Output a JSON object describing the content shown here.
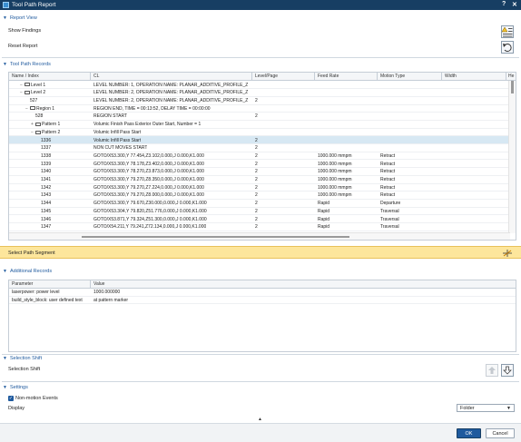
{
  "window": {
    "title": "Tool Path Report",
    "help_glyph": "?",
    "close_glyph": "✕"
  },
  "report_view": {
    "header": "Report View",
    "show_findings": "Show Findings",
    "reset_report": "Reset Report"
  },
  "records": {
    "header": "Tool Path Records",
    "columns": [
      "Name / Index",
      "CL",
      "Level/Page",
      "Feed Rate",
      "Motion Type",
      "Width",
      "He"
    ],
    "rows": [
      {
        "indent": 2,
        "expander": "−",
        "folder": true,
        "name": "Level 1",
        "cl": "LEVEL NUMBER: 1, OPERATION NAME: PLANAR_ADDITIVE_PROFILE_Z...",
        "level": "",
        "feed": "",
        "motion": "",
        "selected": false
      },
      {
        "indent": 2,
        "expander": "−",
        "folder": true,
        "name": "Level 2",
        "cl": "LEVEL NUMBER: 2, OPERATION NAME: PLANAR_ADDITIVE_PROFILE_Z...",
        "level": "",
        "feed": "",
        "motion": "",
        "selected": false
      },
      {
        "indent": 3,
        "expander": "",
        "folder": false,
        "name": "527",
        "cl": "LEVEL NUMBER: 2, OPERATION NAME: PLANAR_ADDITIVE_PROFILE_Z...",
        "level": "2",
        "feed": "",
        "motion": "",
        "selected": false
      },
      {
        "indent": 3,
        "expander": "−",
        "folder": true,
        "name": "Region 1",
        "cl": "REGION END, TIME = 00:13:52, DELAY TIME = 00:00:00",
        "level": "",
        "feed": "",
        "motion": "",
        "selected": false
      },
      {
        "indent": 4,
        "expander": "",
        "folder": false,
        "name": "528",
        "cl": "REGION START",
        "level": "2",
        "feed": "",
        "motion": "",
        "selected": false
      },
      {
        "indent": 4,
        "expander": "+",
        "folder": true,
        "name": "Pattern 1",
        "cl": "Volumic Finish Pass Exterior Outer Start, Number = 1",
        "level": "",
        "feed": "",
        "motion": "",
        "selected": false
      },
      {
        "indent": 4,
        "expander": "−",
        "folder": true,
        "name": "Pattern 2",
        "cl": "Volumic Infill Pass Start",
        "level": "",
        "feed": "",
        "motion": "",
        "selected": false
      },
      {
        "indent": 5,
        "expander": "",
        "folder": false,
        "name": "1336",
        "cl": "Volumic Infill Pass Start",
        "level": "2",
        "feed": "",
        "motion": "",
        "selected": true
      },
      {
        "indent": 5,
        "expander": "",
        "folder": false,
        "name": "1337",
        "cl": "NON CUT MOVES START",
        "level": "2",
        "feed": "",
        "motion": "",
        "selected": false
      },
      {
        "indent": 5,
        "expander": "",
        "folder": false,
        "name": "1338",
        "cl": "GOTO/X53.300,Y 77.454,Z3.102,0.000,J 0.000,K1.000",
        "level": "2",
        "feed": "1000.000 mmpm",
        "motion": "Retract",
        "selected": false
      },
      {
        "indent": 5,
        "expander": "",
        "folder": false,
        "name": "1339",
        "cl": "GOTO/X53.300,Y 78.178,Z3.402,0.000,J 0.000,K1.000",
        "level": "2",
        "feed": "1000.000 mmpm",
        "motion": "Retract",
        "selected": false
      },
      {
        "indent": 5,
        "expander": "",
        "folder": false,
        "name": "1340",
        "cl": "GOTO/X53.300,Y 78.270,Z3.873,0.000,J 0.000,K1.000",
        "level": "2",
        "feed": "1000.000 mmpm",
        "motion": "Retract",
        "selected": false
      },
      {
        "indent": 5,
        "expander": "",
        "folder": false,
        "name": "1341",
        "cl": "GOTO/X53.300,Y 79.270,Z8.350,0.000,J 0.000,K1.000",
        "level": "2",
        "feed": "1000.000 mmpm",
        "motion": "Retract",
        "selected": false
      },
      {
        "indent": 5,
        "expander": "",
        "folder": false,
        "name": "1342",
        "cl": "GOTO/X53.300,Y 79.270,Z7.224,0.000,J 0.000,K1.000",
        "level": "2",
        "feed": "1000.000 mmpm",
        "motion": "Retract",
        "selected": false
      },
      {
        "indent": 5,
        "expander": "",
        "folder": false,
        "name": "1343",
        "cl": "GOTO/X53.300,Y 79.270,Z8.000,0.000,J 0.000,K1.000",
        "level": "2",
        "feed": "1000.000 mmpm",
        "motion": "Retract",
        "selected": false
      },
      {
        "indent": 5,
        "expander": "",
        "folder": false,
        "name": "1344",
        "cl": "GOTO/X53.300,Y 79.670,Z30.000,0.000,J 0.000,K1.000",
        "level": "2",
        "feed": "Rapid",
        "motion": "Departure",
        "selected": false
      },
      {
        "indent": 5,
        "expander": "",
        "folder": false,
        "name": "1345",
        "cl": "GOTO/X53.304,Y 79.820,Z51.776,0.000,J 0.000,K1.000",
        "level": "2",
        "feed": "Rapid",
        "motion": "Traversal",
        "selected": false
      },
      {
        "indent": 5,
        "expander": "",
        "folder": false,
        "name": "1346",
        "cl": "GOTO/X53.871,Y 79.324,Z51.300,0.000,J 0.000,K1.000",
        "level": "2",
        "feed": "Rapid",
        "motion": "Traversal",
        "selected": false
      },
      {
        "indent": 5,
        "expander": "",
        "folder": false,
        "name": "1347",
        "cl": "GOTO/X54.211,Y 79.241,Z72.134,0.000,J 0.000,K1.000",
        "level": "2",
        "feed": "Rapid",
        "motion": "Traversal",
        "selected": false
      }
    ]
  },
  "status": {
    "select_path": "Select Path Segment"
  },
  "additional": {
    "header": "Additional Records",
    "columns": [
      "Parameter",
      "Value"
    ],
    "rows": [
      {
        "param": "laserpower: power level",
        "value": "1000.000000"
      },
      {
        "param": "build_style_block: user defined text",
        "value": "at pattern marker"
      }
    ]
  },
  "selection_shift": {
    "header": "Selection Shift",
    "label": "Selection Shift"
  },
  "settings": {
    "header": "Settings",
    "non_motion": "Non-motion Events",
    "display_label": "Display",
    "display_value": "Folder",
    "expand_glyph": "▲"
  },
  "footer": {
    "ok": "OK",
    "cancel": "Cancel"
  },
  "colors": {
    "accent": "#1f5a9e",
    "titlebar": "#173e63",
    "status_bg": "#fde69c",
    "selected_row": "#d7e8f3"
  }
}
